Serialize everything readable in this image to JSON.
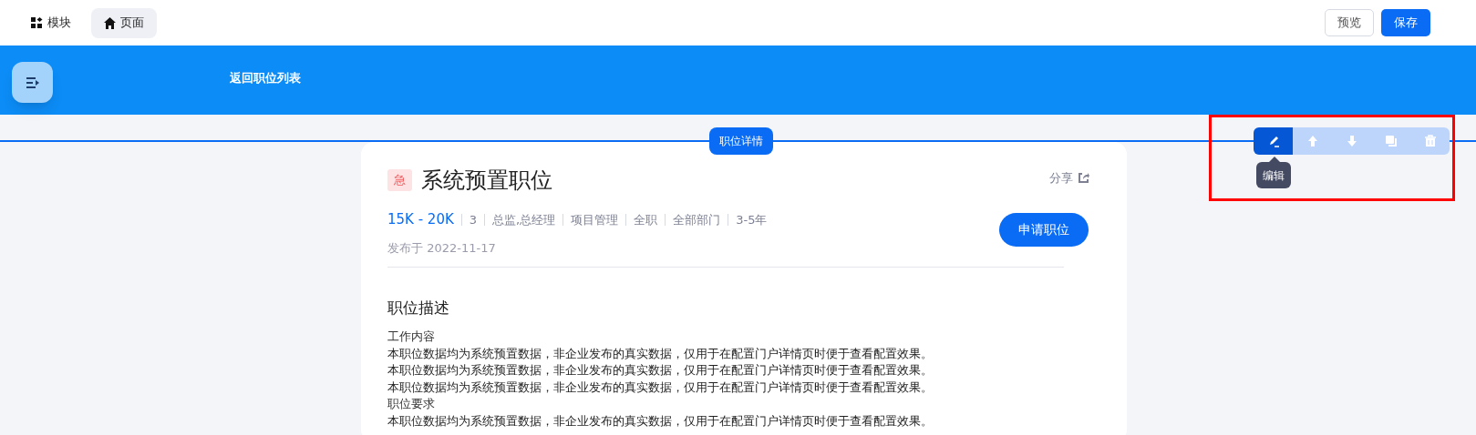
{
  "top_bar": {
    "tabs": [
      {
        "label": "模块",
        "selected": false
      },
      {
        "label": "页面",
        "selected": true
      }
    ],
    "buttons": [
      {
        "label": "预览",
        "kind": "secondary"
      },
      {
        "label": "保存",
        "kind": "primary"
      }
    ]
  },
  "banner": {
    "back_link": "返回职位列表"
  },
  "section_label": "职位详情",
  "toolbar": {
    "tools": [
      {
        "selected": true
      },
      {
        "selected": false
      },
      {
        "selected": false
      },
      {
        "selected": false
      },
      {
        "selected": false
      }
    ],
    "tooltip": "编辑"
  },
  "job": {
    "tag": "急",
    "title": "系统预置职位",
    "share": "分享",
    "salary": "15K - 20K",
    "meta": [
      "3",
      "总监,总经理",
      "项目管理",
      "全职",
      "全部部门",
      "3-5年"
    ],
    "posted": "发布于 2022-11-17",
    "apply_button": "申请职位",
    "description": {
      "heading": "职位描述",
      "lines": [
        {
          "kind": "subheading",
          "text": "工作内容"
        },
        {
          "kind": "text",
          "text": "本职位数据均为系统预置数据，非企业发布的真实数据，仅用于在配置门户详情页时便于查看配置效果。"
        },
        {
          "kind": "text",
          "text": "本职位数据均为系统预置数据，非企业发布的真实数据，仅用于在配置门户详情页时便于查看配置效果。"
        },
        {
          "kind": "text",
          "text": "本职位数据均为系统预置数据，非企业发布的真实数据，仅用于在配置门户详情页时便于查看配置效果。"
        },
        {
          "kind": "subheading",
          "text": "职位要求"
        },
        {
          "kind": "text",
          "text": "本职位数据均为系统预置数据，非企业发布的真实数据，仅用于在配置门户详情页时便于查看配置效果。"
        }
      ]
    }
  }
}
